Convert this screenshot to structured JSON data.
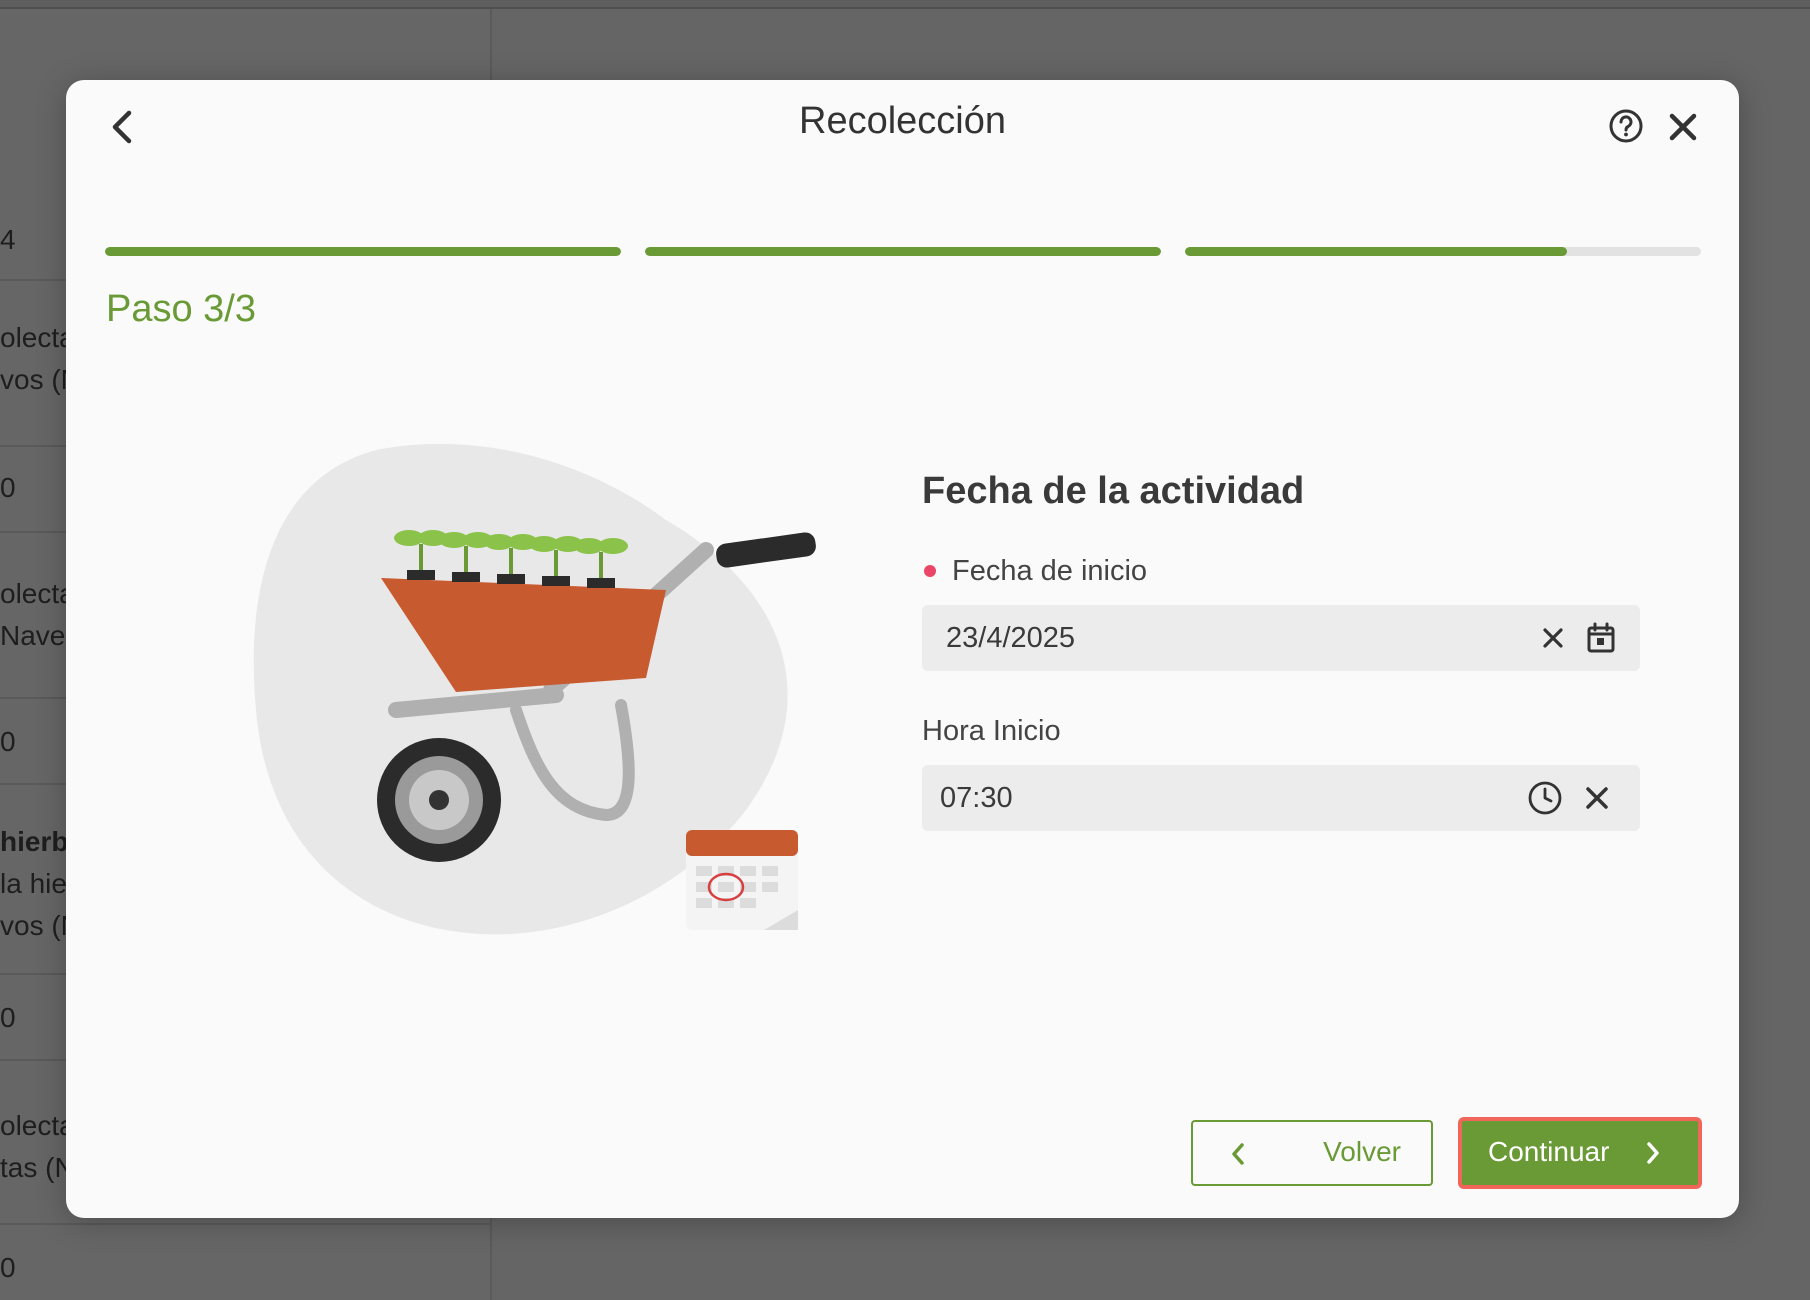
{
  "background": {
    "rows": [
      {
        "lines": [
          "4"
        ]
      },
      {
        "lines": [
          "olecta",
          "vos (N"
        ]
      },
      {
        "lines": [
          "0"
        ]
      },
      {
        "lines": [
          "olecta",
          "Nave"
        ]
      },
      {
        "lines": [
          "0"
        ]
      },
      {
        "lines": [
          "hierb",
          "la hie",
          "vos (N"
        ],
        "bold_first": true
      },
      {
        "lines": [
          "0"
        ]
      },
      {
        "lines": [
          "olecta",
          "tas (N"
        ]
      },
      {
        "lines": [
          "0"
        ]
      }
    ]
  },
  "modal": {
    "title": "Recolección",
    "step_label": "Paso 3/3",
    "progress": [
      1.0,
      1.0,
      0.74
    ],
    "section_title": "Fecha de la actividad",
    "fields": {
      "start_date": {
        "label": "Fecha de inicio",
        "value": "23/4/2025",
        "required": true
      },
      "start_time": {
        "label": "Hora Inicio",
        "value": "07:30",
        "required": false
      }
    },
    "buttons": {
      "back_label": "Volver",
      "continue_label": "Continuar"
    }
  },
  "colors": {
    "accent": "#6a9a35",
    "required": "#e94668",
    "focus_ring": "#f0665a",
    "wheelbarrow": "#c85a30"
  },
  "icons": {
    "back": "chevron-left-icon",
    "help": "help-circle-icon",
    "close": "close-icon",
    "clear": "clear-icon",
    "calendar": "calendar-icon",
    "clock": "clock-icon"
  }
}
